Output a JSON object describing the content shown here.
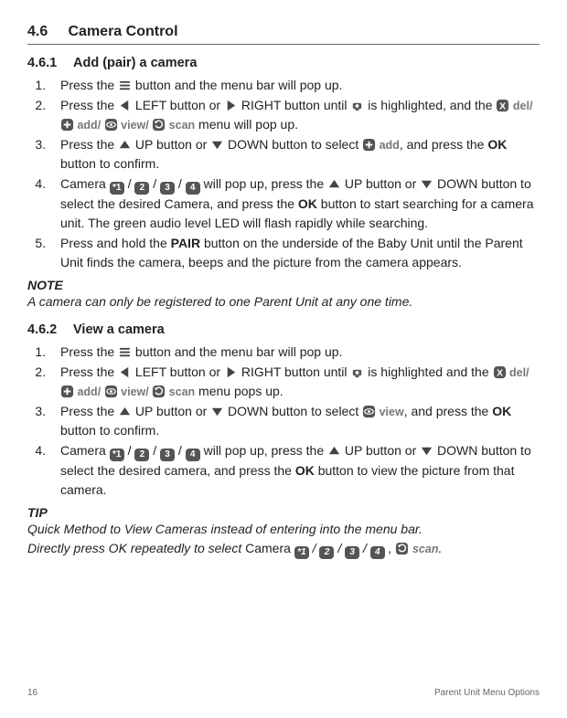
{
  "header": {
    "num": "4.6",
    "title": "Camera Control"
  },
  "sections": [
    {
      "num": "4.6.1",
      "title": "Add (pair) a camera",
      "steps": [
        {
          "idx": "1",
          "frags": [
            {
              "t": "Press the "
            },
            {
              "icon": "menu"
            },
            {
              "t": " button and the menu bar will pop up."
            }
          ]
        },
        {
          "idx": "2",
          "frags": [
            {
              "t": "Press the "
            },
            {
              "icon": "left"
            },
            {
              "t": " LEFT button or "
            },
            {
              "icon": "right"
            },
            {
              "t": " RIGHT button until "
            },
            {
              "icon": "cam"
            },
            {
              "t": " is highlighted, and the "
            },
            {
              "icon": "x"
            },
            {
              "g": " del/ "
            },
            {
              "icon": "plus"
            },
            {
              "g": " add/ "
            },
            {
              "icon": "eye"
            },
            {
              "g": " view/ "
            },
            {
              "icon": "cycle"
            },
            {
              "g": " scan"
            },
            {
              "t": " menu will pop up."
            }
          ]
        },
        {
          "idx": "3",
          "frags": [
            {
              "t": "Press the "
            },
            {
              "icon": "up"
            },
            {
              "t": " UP button or "
            },
            {
              "icon": "down"
            },
            {
              "t": " DOWN button to select "
            },
            {
              "icon": "plus"
            },
            {
              "g": " add"
            },
            {
              "t": ", and press the "
            },
            {
              "ok": "OK"
            },
            {
              "t": " button to confirm."
            }
          ]
        },
        {
          "idx": "4",
          "frags": [
            {
              "t": "Camera "
            },
            {
              "num": "*1"
            },
            {
              "t": " / "
            },
            {
              "num": "2"
            },
            {
              "t": " / "
            },
            {
              "num": "3"
            },
            {
              "t": " / "
            },
            {
              "num": "4"
            },
            {
              "t": "  will pop up, press the "
            },
            {
              "icon": "up"
            },
            {
              "t": " UP button or "
            },
            {
              "icon": "down"
            },
            {
              "t": " DOWN button to select the desired Camera, and press the "
            },
            {
              "ok": "OK"
            },
            {
              "t": " button to start searching for a camera unit. The green audio level LED will flash rapidly while searching."
            }
          ]
        },
        {
          "idx": "5",
          "frags": [
            {
              "t": "Press and hold the "
            },
            {
              "b": "PAIR"
            },
            {
              "t": " button on the underside of the Baby Unit until the Parent Unit finds the camera, beeps and the picture from the camera appears."
            }
          ]
        }
      ],
      "note_label": "NOTE",
      "note_text": "A camera can only be registered to one Parent Unit at any one time."
    },
    {
      "num": "4.6.2",
      "title": "View a camera",
      "steps": [
        {
          "idx": "1",
          "frags": [
            {
              "t": "Press the "
            },
            {
              "icon": "menu"
            },
            {
              "t": " button and the menu bar will pop up."
            }
          ]
        },
        {
          "idx": "2",
          "frags": [
            {
              "t": "Press the "
            },
            {
              "icon": "left"
            },
            {
              "t": " LEFT button or "
            },
            {
              "icon": "right"
            },
            {
              "t": " RIGHT button until "
            },
            {
              "icon": "cam"
            },
            {
              "t": " is highlighted and the "
            },
            {
              "icon": "x"
            },
            {
              "g": " del/ "
            },
            {
              "icon": "plus"
            },
            {
              "g": " add/ "
            },
            {
              "icon": "eye"
            },
            {
              "g": " view/ "
            },
            {
              "icon": "cycle"
            },
            {
              "g": " scan"
            },
            {
              "t": " menu pops up."
            }
          ]
        },
        {
          "idx": "3",
          "frags": [
            {
              "t": "Press the "
            },
            {
              "icon": "up"
            },
            {
              "t": " UP button or "
            },
            {
              "icon": "down"
            },
            {
              "t": " DOWN button to select "
            },
            {
              "icon": "eye"
            },
            {
              "g": " view"
            },
            {
              "t": ", and press the "
            },
            {
              "ok": "OK"
            },
            {
              "t": " button to confirm."
            }
          ]
        },
        {
          "idx": "4",
          "frags": [
            {
              "t": "Camera "
            },
            {
              "num": "*1"
            },
            {
              "t": " / "
            },
            {
              "num": "2"
            },
            {
              "t": " / "
            },
            {
              "num": "3"
            },
            {
              "t": " / "
            },
            {
              "num": "4"
            },
            {
              "t": "  will pop up, press the "
            },
            {
              "icon": "up"
            },
            {
              "t": " UP button or "
            },
            {
              "icon": "down"
            },
            {
              "t": " DOWN button to select the desired camera, and press the  "
            },
            {
              "ok": "OK"
            },
            {
              "t": " button to view the picture from that camera."
            }
          ]
        }
      ],
      "tip_label": "TIP",
      "tip_text_frags": [
        {
          "t": "Quick Method to View Cameras instead of entering into the menu bar."
        },
        {
          "br": true
        },
        {
          "t": "Directly press OK repeatedly to select "
        },
        {
          "r": "Camera "
        },
        {
          "num": "*1"
        },
        {
          "t": " / "
        },
        {
          "num": "2"
        },
        {
          "t": " / "
        },
        {
          "num": "3"
        },
        {
          "t": " / "
        },
        {
          "num": "4"
        },
        {
          "t": " ,  "
        },
        {
          "icon": "cycle"
        },
        {
          "g": " scan"
        },
        {
          "t": "."
        }
      ]
    }
  ],
  "footer": {
    "page": "16",
    "label": "Parent Unit Menu Options"
  }
}
